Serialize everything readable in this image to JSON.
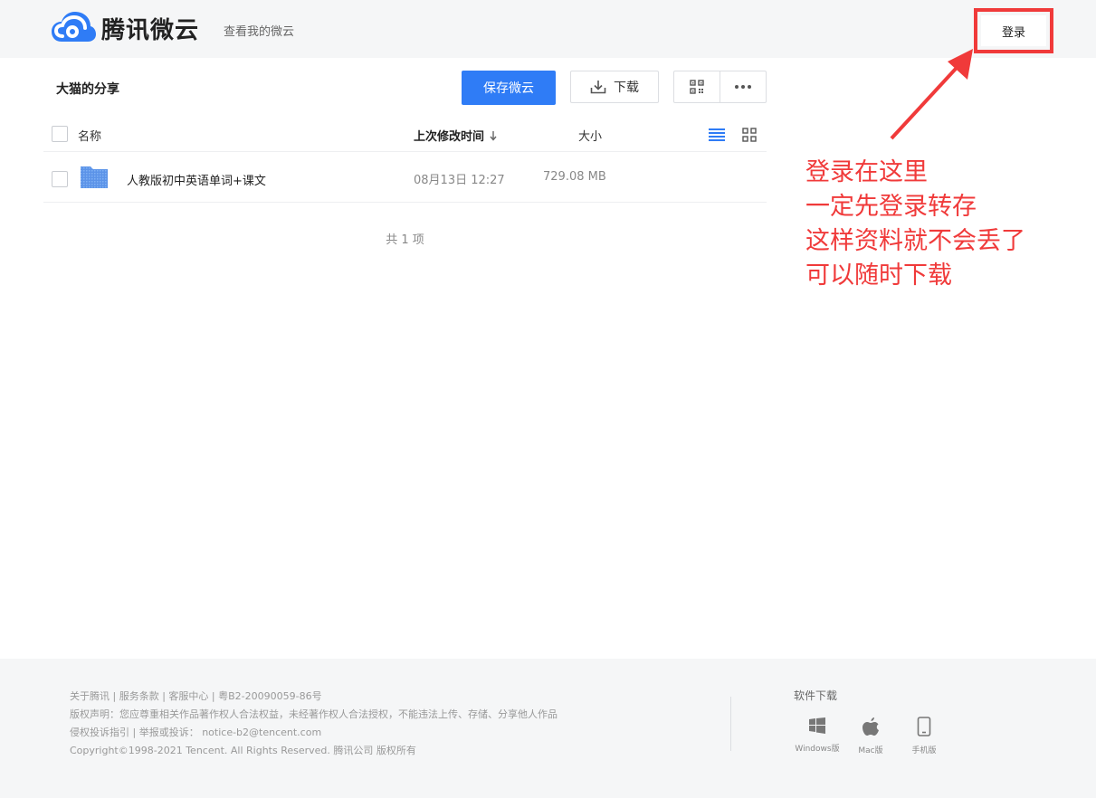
{
  "header": {
    "logo_text": "腾讯微云",
    "my_cloud_link": "查看我的微云",
    "login_label": "登录"
  },
  "share": {
    "title": "大猫的分享",
    "save_label": "保存微云",
    "download_label": "下载"
  },
  "table": {
    "columns": {
      "name": "名称",
      "mtime": "上次修改时间",
      "size": "大小"
    },
    "rows": [
      {
        "name": "人教版初中英语单词+课文",
        "mtime": "08月13日 12:27",
        "size": "729.08 MB"
      }
    ],
    "count_text": "共 1 项"
  },
  "annotation": {
    "lines": [
      "登录在这里",
      "一定先登录转存",
      "这样资料就不会丢了",
      "可以随时下载"
    ],
    "color": "#f03a3a"
  },
  "footer": {
    "line1": "关于腾讯 | 服务条款 | 客服中心 | 粤B2-20090059-86号",
    "line2": "版权声明：您应尊重相关作品著作权人合法权益，未经著作权人合法授权，不能违法上传、存储、分享他人作品",
    "line3": "侵权投诉指引 | 举报或投诉： notice-b2@tencent.com",
    "line4": "Copyright©1998-2021 Tencent. All Rights Reserved. 腾讯公司 版权所有",
    "download_title": "软件下载",
    "platforms": [
      {
        "label": "Windows版",
        "icon": "windows-icon"
      },
      {
        "label": "Mac版",
        "icon": "apple-icon"
      },
      {
        "label": "手机版",
        "icon": "phone-icon"
      }
    ]
  },
  "colors": {
    "accent": "#2f7cf6",
    "annotation": "#f03a3a"
  }
}
